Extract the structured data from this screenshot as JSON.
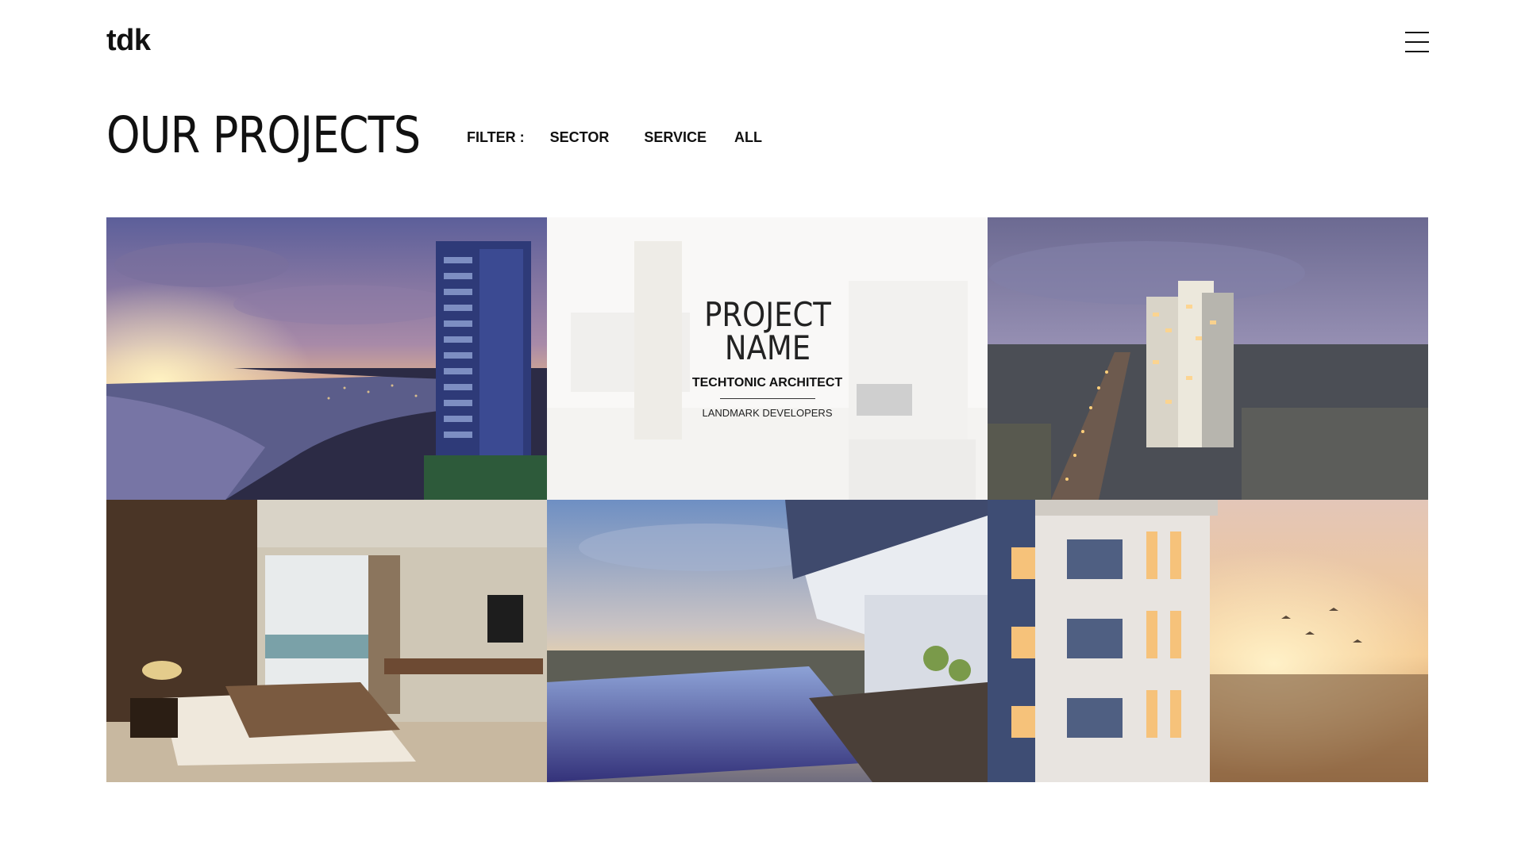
{
  "header": {
    "logo": "tdk",
    "menu_icon": "hamburger-menu-icon"
  },
  "page": {
    "title": "OUR PROJECTS"
  },
  "filter": {
    "label": "FILTER :",
    "options": [
      "SECTOR",
      "SERVICE",
      "ALL"
    ]
  },
  "projects": [
    {
      "image": "coastal-tower-sunset-image"
    },
    {
      "image": "kitchen-interior-image",
      "overlay": {
        "name": "PROJECT NAME",
        "architect": "TECHTONIC ARCHITECT",
        "developer": "LANDMARK DEVELOPERS"
      }
    },
    {
      "image": "city-tower-dusk-image"
    },
    {
      "image": "bedroom-interior-image"
    },
    {
      "image": "rooftop-pool-image"
    },
    {
      "image": "apartment-balconies-image"
    }
  ]
}
